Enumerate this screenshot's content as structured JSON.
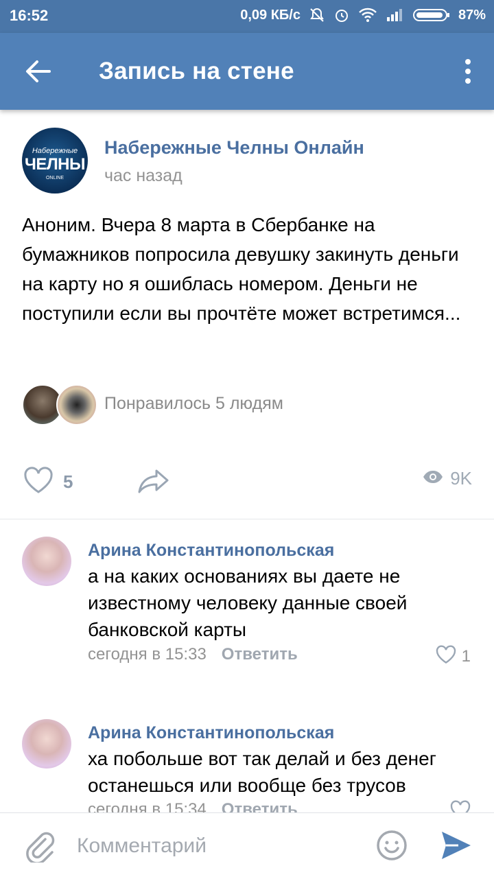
{
  "status_bar": {
    "time": "16:52",
    "network_speed": "0,09 КБ/с",
    "battery": "87%"
  },
  "app_bar": {
    "title": "Запись на стене",
    "back_icon": "arrow-left-icon",
    "menu_icon": "more-vertical-icon"
  },
  "post": {
    "author": "Набережные Челны Онлайн",
    "time": "час назад",
    "logo": {
      "line1": "Набережные",
      "line2": "ЧЕЛНЫ",
      "line3": "ONLINE"
    },
    "text": "Аноним. Вчера 8 марта в Сбербанке на бумажников попросила девушку закинуть деньги на карту но я ошиблась номером. Деньги не поступили если вы прочтёте может встретимся...",
    "liked_by_text": "Понравилось 5 людям",
    "likes": "5",
    "views": "9K"
  },
  "comments": [
    {
      "author": "Арина Константинопольская",
      "text": "а на каких основаниях вы даете не известному человеку данные своей банковской карты",
      "time": "сегодня в 15:33",
      "reply": "Ответить",
      "likes": "1"
    },
    {
      "author": "Арина Константинопольская",
      "text": "ха побольше вот так делай и без денег останешься или вообще без трусов",
      "time": "сегодня в 15:34",
      "reply": "Ответить",
      "likes": ""
    }
  ],
  "composer": {
    "placeholder": "Комментарий"
  },
  "colors": {
    "status_bar": "#4a76a8",
    "app_bar": "#5181b8",
    "link": "#4a6fa0",
    "secondary_text": "#939393",
    "send": "#5181b8"
  }
}
